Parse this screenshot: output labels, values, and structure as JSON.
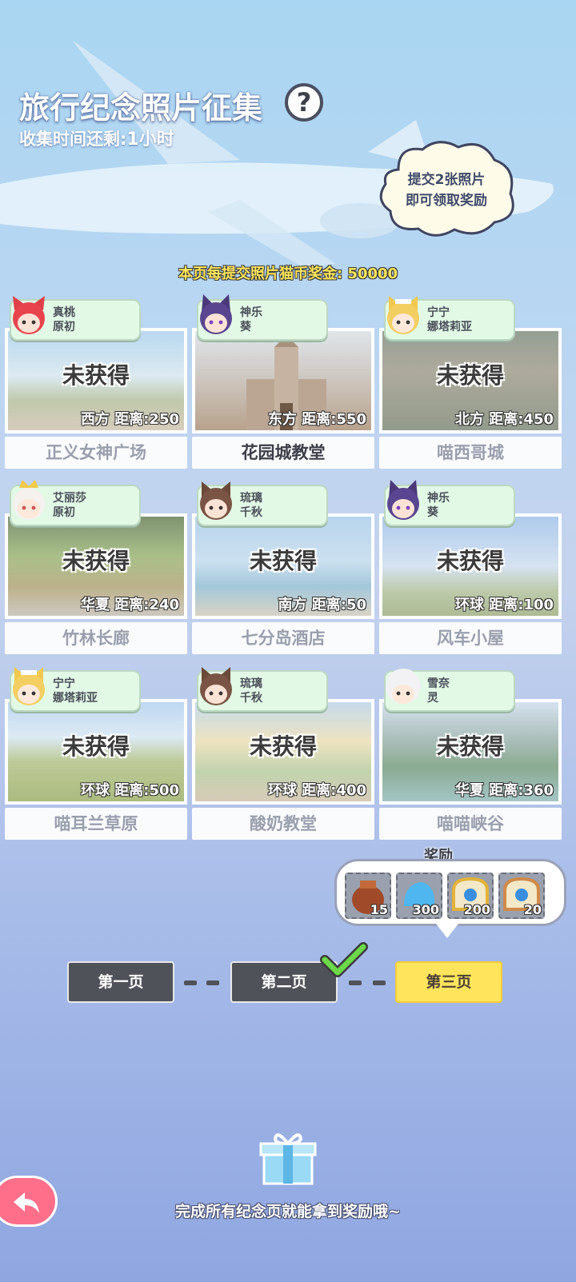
{
  "header": {
    "title": "旅行纪念照片征集",
    "help_label": "?",
    "time_label": "收集时间还剩:",
    "time_value": "1小时",
    "tip_line1": "提交2张照片",
    "tip_line2": "即可领取奖励",
    "bonus_text": "本页每提交照片猫币奖金: 50000"
  },
  "cards": [
    {
      "char1": "真桃",
      "char2": "原初",
      "status": "未获得",
      "location": "西方  距离:250",
      "name": "正义女神广场"
    },
    {
      "char1": "神乐",
      "char2": "葵",
      "status": "",
      "location": "东方  距离:550",
      "name": "花园城教堂"
    },
    {
      "char1": "宁宁",
      "char2": "娜塔莉亚",
      "status": "未获得",
      "location": "北方  距离:450",
      "name": "喵西哥城"
    },
    {
      "char1": "艾丽莎",
      "char2": "原初",
      "status": "未获得",
      "location": "华夏  距离:240",
      "name": "竹林长廊"
    },
    {
      "char1": "琉璃",
      "char2": "千秋",
      "status": "未获得",
      "location": "南方  距离:50",
      "name": "七分岛酒店"
    },
    {
      "char1": "神乐",
      "char2": "葵",
      "status": "未获得",
      "location": "环球  距离:100",
      "name": "风车小屋"
    },
    {
      "char1": "宁宁",
      "char2": "娜塔莉亚",
      "status": "未获得",
      "location": "环球  距离:500",
      "name": "喵耳兰草原"
    },
    {
      "char1": "琉璃",
      "char2": "千秋",
      "status": "未获得",
      "location": "环球  距离:400",
      "name": "酸奶教堂"
    },
    {
      "char1": "雪奈",
      "char2": "灵",
      "status": "未获得",
      "location": "华夏  距离:360",
      "name": "喵喵峡谷"
    }
  ],
  "rewards": {
    "title": "奖励",
    "items": [
      {
        "icon": "sack-icon",
        "count": "15"
      },
      {
        "icon": "slime-icon",
        "count": "300"
      },
      {
        "icon": "bread-gold-icon",
        "count": "200"
      },
      {
        "icon": "bread-blue-icon",
        "count": "20"
      }
    ]
  },
  "pagination": {
    "page1": "第一页",
    "page2": "第二页",
    "page3": "第三页"
  },
  "footer": {
    "hint": "完成所有纪念页就能拿到奖励哦~"
  },
  "colors": {
    "accent_yellow": "#ffe45c",
    "tag_green": "#e2f9e6",
    "back_pink": "#ff6f8a"
  }
}
